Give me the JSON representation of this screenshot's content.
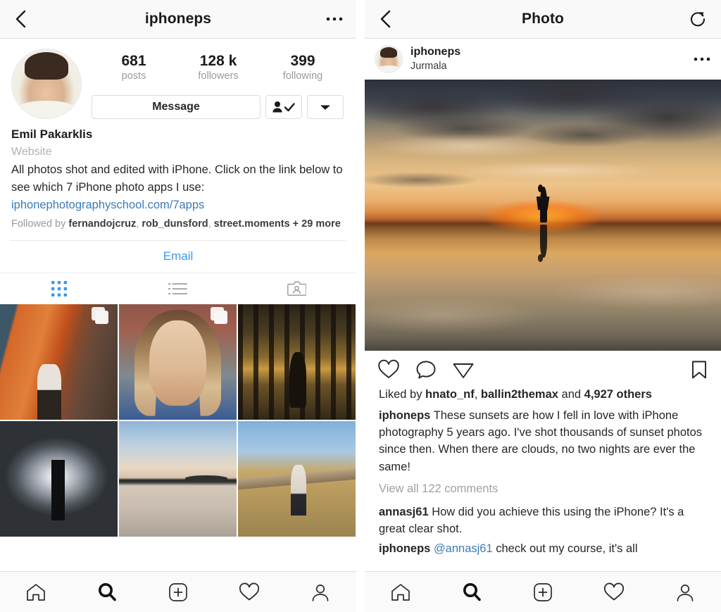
{
  "left": {
    "navbar": {
      "title": "iphoneps",
      "back_icon": "chevron-left-icon",
      "more_icon": "ellipsis-icon"
    },
    "profile": {
      "stats": [
        {
          "value": "681",
          "label": "posts"
        },
        {
          "value": "128 k",
          "label": "followers"
        },
        {
          "value": "399",
          "label": "following"
        }
      ],
      "message_button": "Message",
      "following_icon": "person-check-icon",
      "dropdown_icon": "chevron-down-icon",
      "name": "Emil Pakarklis",
      "website_label": "Website",
      "bio": "All photos shot and edited with iPhone. Click on the link below to see which 7 iPhone photo apps I use:",
      "link": "iphonephotographyschool.com/7apps",
      "followed_by_prefix": "Followed by ",
      "followed_by_names": [
        "fernandojcruz",
        "rob_dunsford",
        "street.moments"
      ],
      "followed_by_suffix": " + 29 more",
      "email_button": "Email"
    },
    "tabs": [
      {
        "name": "grid-tab",
        "icon": "grid-icon",
        "active": true
      },
      {
        "name": "list-tab",
        "icon": "list-icon",
        "active": false
      },
      {
        "name": "tagged-tab",
        "icon": "tagged-person-icon",
        "active": false
      }
    ],
    "grid": [
      {
        "alt": "person walking past orange wall",
        "multi": true
      },
      {
        "alt": "portrait of blonde woman against brick wall",
        "multi": true
      },
      {
        "alt": "silhouette in forest at sunset",
        "multi": false
      },
      {
        "alt": "silhouette with raised arms in fog",
        "multi": false
      },
      {
        "alt": "lake reflection with two figures",
        "multi": false
      },
      {
        "alt": "woman on wooden boardwalk through reeds",
        "multi": false
      }
    ]
  },
  "right": {
    "navbar": {
      "title": "Photo",
      "back_icon": "chevron-left-icon",
      "refresh_icon": "refresh-icon"
    },
    "post": {
      "username": "iphoneps",
      "location": "Jurmala",
      "more_icon": "ellipsis-icon",
      "photo_alt": "silhouette of woman walking on mirror-like water at sunset",
      "actions": {
        "like_icon": "heart-icon",
        "comment_icon": "comment-bubble-icon",
        "share_icon": "paper-plane-icon",
        "save_icon": "bookmark-icon"
      },
      "likes_prefix": "Liked by ",
      "likes_names": [
        "hnato_nf",
        "ballin2themax"
      ],
      "likes_middle": " and ",
      "likes_others": "4,927 others",
      "caption_user": "iphoneps",
      "caption_text": "These sunsets are how I fell in love with iPhone photography 5 years ago. I've shot thousands of sunset photos since then. When there are clouds, no two nights are ever the same!",
      "view_comments": "View all 122 comments",
      "comments": [
        {
          "user": "annasj61",
          "text": "How did you achieve this using the iPhone? It's a great clear shot.",
          "mention": ""
        },
        {
          "user": "iphoneps",
          "mention": "@annasj61",
          "text": " check out my course, it's all"
        }
      ]
    }
  },
  "bottom_nav": [
    {
      "name": "home",
      "icon": "home-icon",
      "active": false
    },
    {
      "name": "search",
      "icon": "search-icon",
      "active": true
    },
    {
      "name": "add",
      "icon": "plus-square-icon",
      "active": false
    },
    {
      "name": "activity",
      "icon": "heart-icon",
      "active": false
    },
    {
      "name": "profile",
      "icon": "person-icon",
      "active": false
    }
  ],
  "colors": {
    "accent_blue": "#3897f0",
    "link_blue": "#3a7cb8",
    "text": "#262626",
    "muted": "#9a9a9a",
    "navbar_bg": "#f9f9f9",
    "border": "#e2e2e2"
  }
}
